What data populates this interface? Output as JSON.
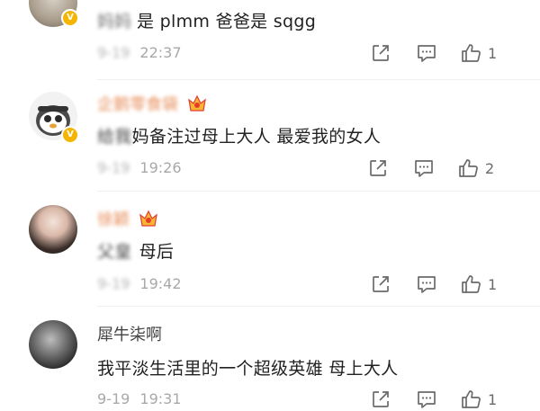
{
  "comments": [
    {
      "username": "妈妈",
      "text_blurred": "",
      "text": "是 plmm 爸爸是 sqgg",
      "date": "9-19",
      "time": "22:37",
      "likes": "1",
      "verified": true,
      "crown": false
    },
    {
      "username": "企鹅零食袋",
      "text_blurred": "给我",
      "text": "妈备注过母上大人 最爱我的女人",
      "date": "9-19",
      "time": "19:26",
      "likes": "2",
      "verified": true,
      "crown": true
    },
    {
      "username": "徐颖",
      "text_blurred": "父皇",
      "text": "母后",
      "date": "9-19",
      "time": "19:42",
      "likes": "1",
      "verified": false,
      "crown": true
    },
    {
      "username": "犀牛柒啊",
      "text_blurred": "",
      "text": "我平淡生活里的一个超级英雄 母上大人",
      "date": "9-19",
      "time": "19:31",
      "likes": "1",
      "verified": false,
      "crown": false
    }
  ],
  "colors": {
    "username_link": "#e2773a",
    "meta_gray": "#a8a8a8",
    "icon_gray": "#6a6a6a",
    "verified_badge": "#f5b400",
    "crown_red": "#e63b2e",
    "crown_gold": "#f7b733"
  },
  "icons": [
    "share-icon",
    "comment-icon",
    "like-icon",
    "verified-badge-icon",
    "crown-badge-icon"
  ]
}
